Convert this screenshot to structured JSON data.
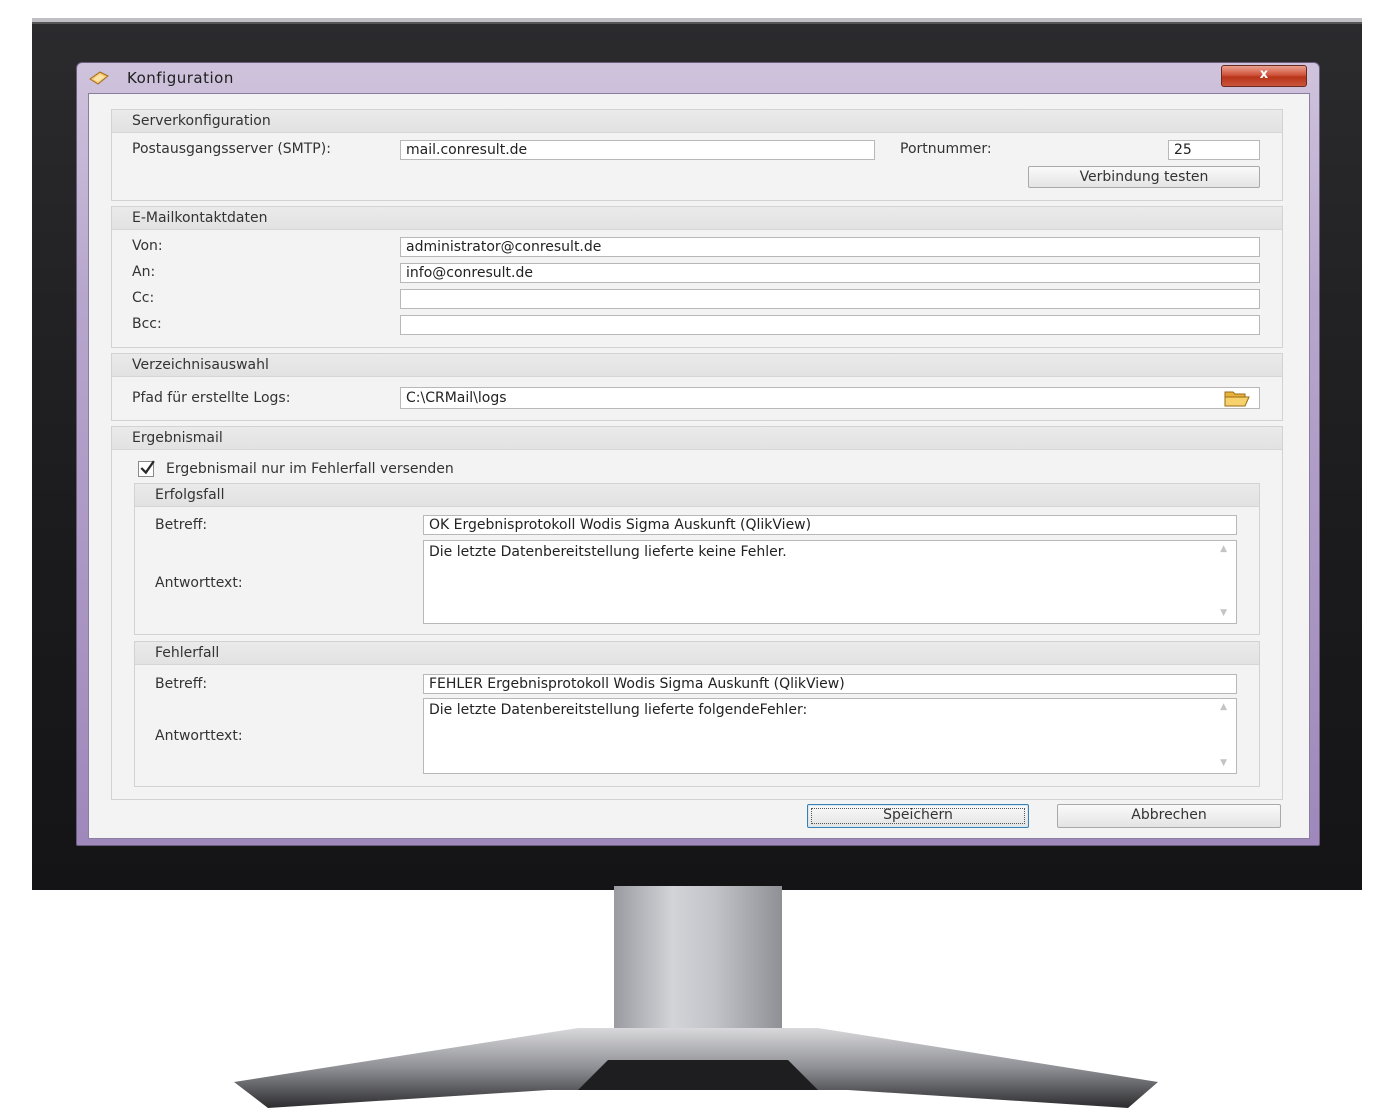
{
  "window": {
    "title": "Konfiguration",
    "close_glyph": "x",
    "icon": "app-icon"
  },
  "server": {
    "group_title": "Serverkonfiguration",
    "smtp_label": "Postausgangsserver (SMTP):",
    "smtp_value": "mail.conresult.de",
    "port_label": "Portnummer:",
    "port_value": "25",
    "test_button": "Verbindung testen"
  },
  "contact": {
    "group_title": "E-Mailkontaktdaten",
    "from_label": "Von:",
    "from_value": "administrator@conresult.de",
    "to_label": "An:",
    "to_value": "info@conresult.de",
    "cc_label": "Cc:",
    "cc_value": "",
    "bcc_label": "Bcc:",
    "bcc_value": ""
  },
  "directory": {
    "group_title": "Verzeichnisauswahl",
    "log_path_label": "Pfad für erstellte Logs:",
    "log_path_value": "C:\\CRMail\\logs",
    "browse_icon": "folder-open-icon"
  },
  "result": {
    "group_title": "Ergebnismail",
    "only_on_error_label": "Ergebnismail nur im Fehlerfall versenden",
    "only_on_error_checked": true,
    "success": {
      "title": "Erfolgsfall",
      "subject_label": "Betreff:",
      "subject_value": "OK Ergebnisprotokoll Wodis Sigma Auskunft (QlikView)",
      "body_label": "Antworttext:",
      "body_value": "Die letzte Datenbereitstellung lieferte keine Fehler."
    },
    "error": {
      "title": "Fehlerfall",
      "subject_label": "Betreff:",
      "subject_value": "FEHLER Ergebnisprotokoll Wodis Sigma Auskunft (QlikView)",
      "body_label": "Antworttext:",
      "body_value": "Die letzte Datenbereitstellung lieferte folgendeFehler:"
    }
  },
  "footer": {
    "save_button": "Speichern",
    "cancel_button": "Abbrechen"
  }
}
